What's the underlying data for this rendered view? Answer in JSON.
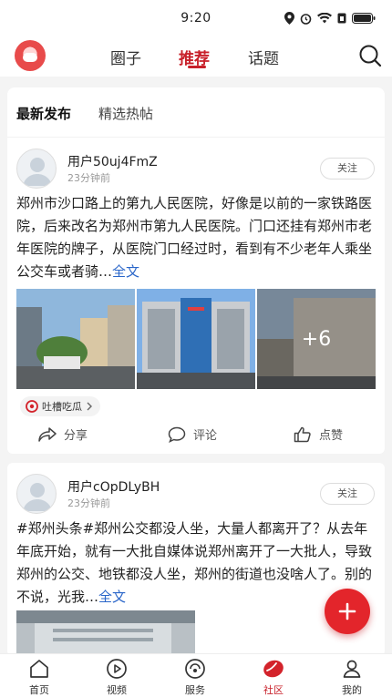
{
  "status_bar": {
    "time": "9:20"
  },
  "top_nav": {
    "tabs": [
      {
        "label": "圈子",
        "active": false
      },
      {
        "label": "推荐",
        "active": true
      },
      {
        "label": "话题",
        "active": false
      }
    ]
  },
  "feed_tabs": {
    "latest": "最新发布",
    "featured": "精选热帖"
  },
  "posts": [
    {
      "username": "用户50uj4FmZ",
      "time": "23分钟前",
      "follow_label": "关注",
      "text": "郑州市沙口路上的第九人民医院，好像是以前的一家铁路医院，后来改名为郑州市第九人民医院。门口还挂有郑州市老年医院的牌子，从医院门口经过时，看到有不少老年人乘坐公交车或者骑…",
      "more_label": "全文",
      "extra_images": "+6",
      "topic": "吐槽吃瓜",
      "actions": {
        "share": "分享",
        "comment": "评论",
        "like": "点赞"
      }
    },
    {
      "username": "用户cOpDLyBH",
      "time": "23分钟前",
      "follow_label": "关注",
      "text": "#郑州头条#郑州公交都没人坐，大量人都离开了？从去年年底开始，就有一大批自媒体说郑州离开了一大批人，导致郑州的公交、地铁都没人坐，郑州的街道也没啥人了。别的不说，光我…",
      "more_label": "全文"
    }
  ],
  "bottom_nav": [
    {
      "label": "首页",
      "icon": "home-icon",
      "active": false
    },
    {
      "label": "视频",
      "icon": "play-icon",
      "active": false
    },
    {
      "label": "服务",
      "icon": "service-icon",
      "active": false
    },
    {
      "label": "社区",
      "icon": "community-icon",
      "active": true
    },
    {
      "label": "我的",
      "icon": "profile-icon",
      "active": false
    }
  ],
  "colors": {
    "accent": "#c8202a",
    "fab": "#e3252b",
    "link": "#2a66c9"
  }
}
